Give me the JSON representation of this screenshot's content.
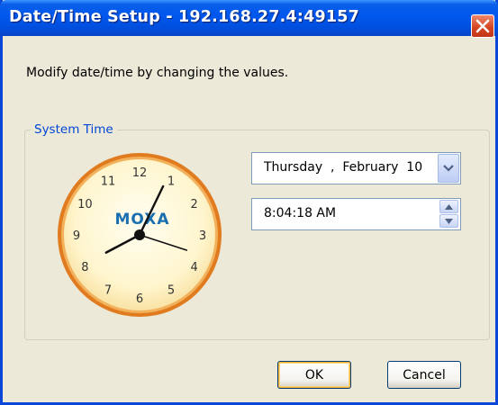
{
  "window": {
    "title": "Date/Time Setup - 192.168.27.4:49157"
  },
  "instruction": "Modify date/time by changing the values.",
  "group": {
    "label": "System Time"
  },
  "clock": {
    "brand": "MOXA",
    "numbers": [
      "12",
      "1",
      "2",
      "3",
      "4",
      "5",
      "6",
      "7",
      "8",
      "9",
      "10",
      "11"
    ],
    "time": {
      "hours": 8,
      "minutes": 4,
      "seconds": 18
    }
  },
  "date_picker": {
    "value": "Thursday  ,  February  10"
  },
  "time_picker": {
    "value": "8:04:18 AM"
  },
  "buttons": {
    "ok": "OK",
    "cancel": "Cancel"
  },
  "icons": {
    "close": "close-icon",
    "dropdown": "chevron-down-icon",
    "spin_up": "spin-up-icon",
    "spin_down": "spin-down-icon"
  },
  "colors": {
    "title_bar": "#0058ee",
    "close_button": "#d3421e",
    "group_label": "#0046d5",
    "clock_rim": "#e07b1f",
    "clock_face": "#fff6cf",
    "moxa_blue": "#1a6fb0"
  }
}
